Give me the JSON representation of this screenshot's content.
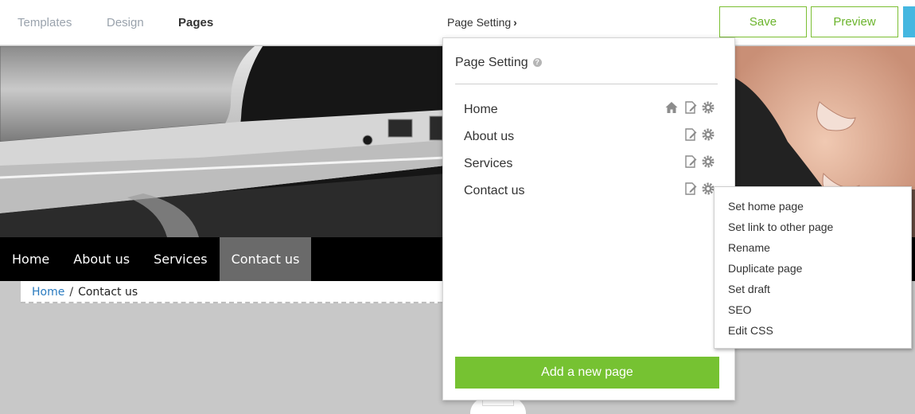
{
  "toolbar": {
    "tabs": [
      "Templates",
      "Design",
      "Pages"
    ],
    "page_setting_link": "Page Setting",
    "save_label": "Save",
    "preview_label": "Preview",
    "colors": {
      "accent_green": "#76c232",
      "accent_blue": "#45b7e0"
    }
  },
  "site": {
    "nav": [
      "Home",
      "About us",
      "Services",
      "Contact us"
    ],
    "active_nav": "Contact us",
    "breadcrumb": {
      "home": "Home",
      "separator": "/",
      "current": "Contact us"
    }
  },
  "panel": {
    "title": "Page Setting",
    "help_icon": "question-circle-icon",
    "pages": [
      {
        "name": "Home",
        "icons": [
          "home-icon",
          "edit-page-icon",
          "gear-icon"
        ]
      },
      {
        "name": "About us",
        "icons": [
          "edit-page-icon",
          "gear-icon"
        ]
      },
      {
        "name": "Services",
        "icons": [
          "edit-page-icon",
          "gear-icon"
        ]
      },
      {
        "name": "Contact us",
        "icons": [
          "edit-page-icon",
          "gear-icon"
        ]
      }
    ],
    "add_button": "Add a new page"
  },
  "context_menu": {
    "items": [
      "Set home page",
      "Set link to other page",
      "Rename",
      "Duplicate page",
      "Set draft",
      "SEO",
      "Edit CSS"
    ]
  }
}
